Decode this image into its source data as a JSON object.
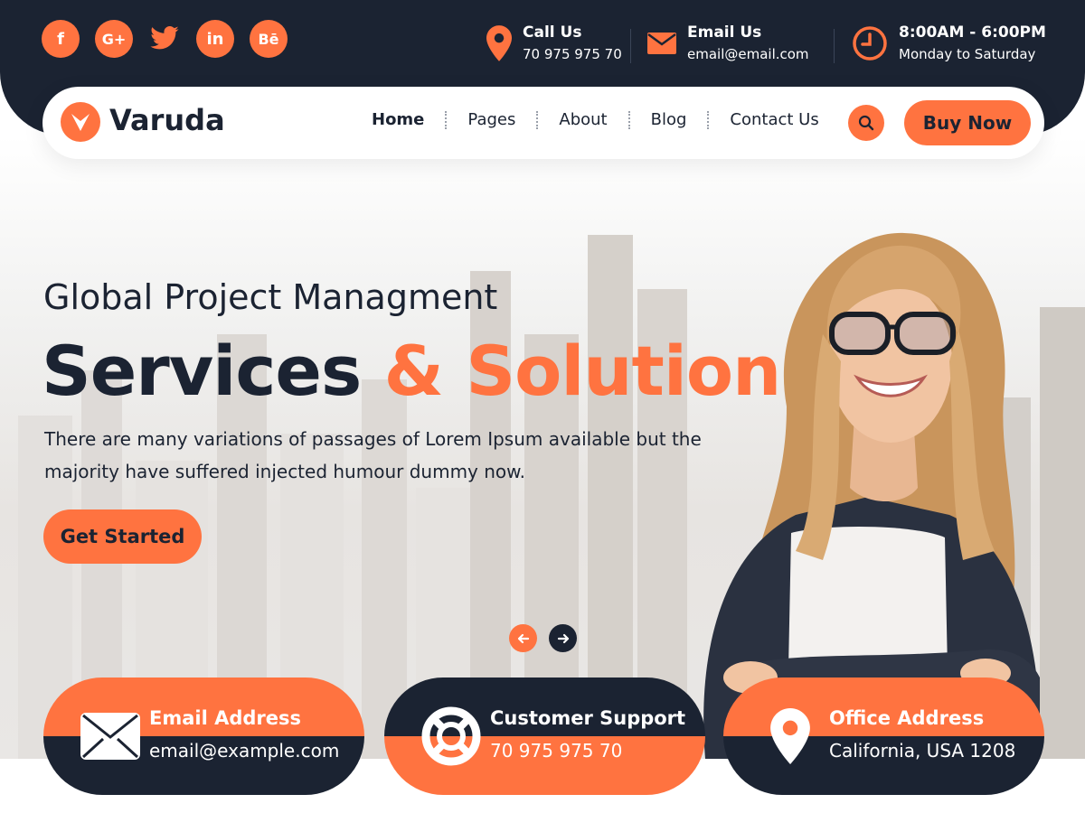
{
  "colors": {
    "accent": "#ff7340",
    "dark": "#1b2332",
    "white": "#ffffff"
  },
  "topbar": {
    "socials": [
      {
        "name": "facebook-icon",
        "glyph": "f"
      },
      {
        "name": "google-plus-icon",
        "glyph": "G+"
      },
      {
        "name": "twitter-icon",
        "glyph": ""
      },
      {
        "name": "linkedin-icon",
        "glyph": "in"
      },
      {
        "name": "behance-icon",
        "glyph": "Bē"
      }
    ],
    "call": {
      "title": "Call Us",
      "value": "70 975 975 70",
      "icon": "location-pin-icon"
    },
    "email": {
      "title": "Email Us",
      "value": "email@email.com",
      "icon": "envelope-icon"
    },
    "hours": {
      "title": "8:00AM - 6:00PM",
      "value": "Monday to Saturday",
      "icon": "clock-icon"
    }
  },
  "nav": {
    "brand": "Varuda",
    "menu": [
      "Home",
      "Pages",
      "About",
      "Blog",
      "Contact Us"
    ],
    "active": "Home",
    "buy_label": "Buy Now",
    "search_icon": "search-icon"
  },
  "hero": {
    "eyebrow": "Global Project Managment",
    "headline_main": "Services",
    "headline_accent": "& Solution",
    "description": "There are many variations of passages of Lorem Ipsum available but the majority have suffered injected humour dummy now.",
    "cta_label": "Get Started",
    "prev_icon": "arrow-left-icon",
    "next_icon": "arrow-right-icon"
  },
  "cards": [
    {
      "title": "Email Address",
      "text": "email@example.com",
      "icon": "envelope-icon"
    },
    {
      "title": "Customer Support",
      "text": "70 975 975 70",
      "icon": "lifebuoy-icon"
    },
    {
      "title": "Office Address",
      "text": "California, USA 1208",
      "icon": "location-pin-icon"
    }
  ]
}
